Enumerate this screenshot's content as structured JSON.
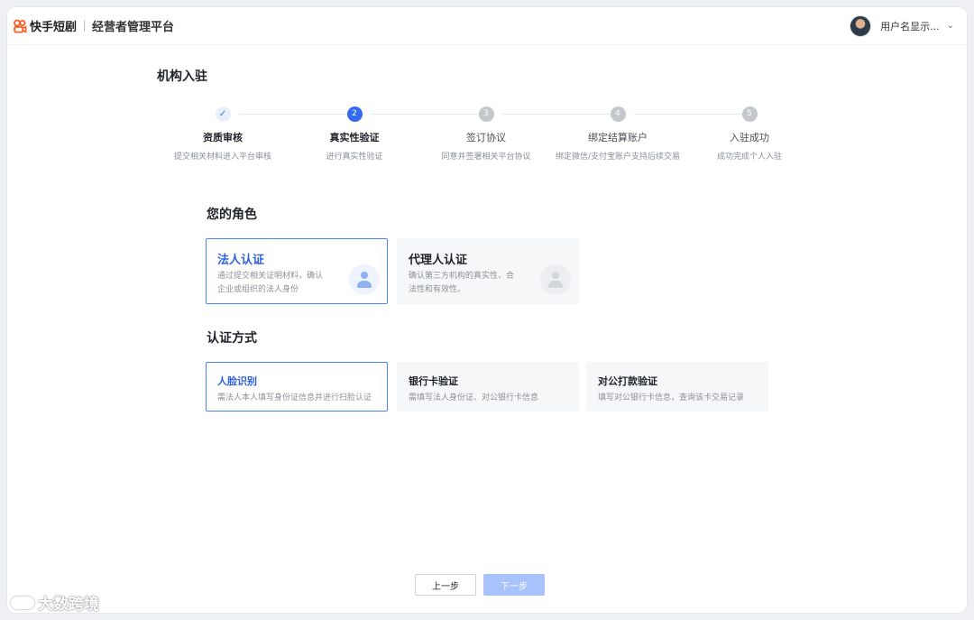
{
  "header": {
    "brand": "快手短剧",
    "platform": "经营者管理平台",
    "user_name": "用户名显示...",
    "dropdown_icon": "chevron-down-icon"
  },
  "page_title": "机构入驻",
  "steps": [
    {
      "number": "✓",
      "status": "done",
      "title": "资质审核",
      "desc": "提交相关材料进入平台审核"
    },
    {
      "number": "2",
      "status": "active",
      "title": "真实性验证",
      "desc": "进行真实性验证"
    },
    {
      "number": "3",
      "status": "pending",
      "title": "签订协议",
      "desc": "同意并签署相关平台协议"
    },
    {
      "number": "4",
      "status": "pending",
      "title": "绑定结算账户",
      "desc": "绑定微信/支付宝账户支持后续交易"
    },
    {
      "number": "5",
      "status": "pending",
      "title": "入驻成功",
      "desc": "成功完成个人入驻"
    }
  ],
  "role_section": {
    "title": "您的角色",
    "options": [
      {
        "title": "法人认证",
        "desc": "通过提交相关证明材料，确认企业或组织的法人身份",
        "selected": true
      },
      {
        "title": "代理人认证",
        "desc": "确认第三方机构的真实性、合法性和有效性。",
        "selected": false
      }
    ]
  },
  "method_section": {
    "title": "认证方式",
    "options": [
      {
        "title": "人脸识别",
        "desc": "需法人本人填写身份证信息并进行扫脸认证",
        "selected": true
      },
      {
        "title": "银行卡验证",
        "desc": "需填写法人身份证、对公银行卡信息",
        "selected": false
      },
      {
        "title": "对公打款验证",
        "desc": "填写对公银行卡信息，查询该卡交易记录",
        "selected": false
      }
    ]
  },
  "footer": {
    "prev_label": "上一步",
    "next_label": "下一步"
  },
  "corner_watermark": "大数跨境",
  "colors": {
    "primary": "#326bf0",
    "primary_disabled": "#a8c3fb",
    "selected_border": "#4e84f2",
    "brand_orange": "#ff5a1f"
  }
}
